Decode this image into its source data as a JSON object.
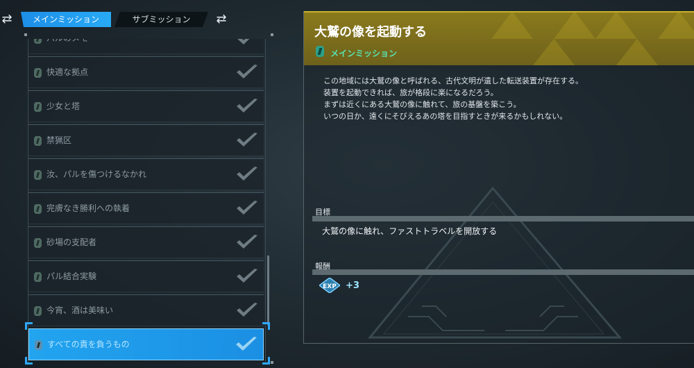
{
  "tabs": {
    "main_label": "メインミッション",
    "sub_label": "サブミッション"
  },
  "quest_list": {
    "items": [
      {
        "label": "パルのメモ",
        "completed": true
      },
      {
        "label": "快適な拠点",
        "completed": true
      },
      {
        "label": "少女と塔",
        "completed": true
      },
      {
        "label": "禁猟区",
        "completed": true
      },
      {
        "label": "汝、パルを傷つけるなかれ",
        "completed": true
      },
      {
        "label": "完膚なき勝利への執着",
        "completed": true
      },
      {
        "label": "砂場の支配者",
        "completed": true
      },
      {
        "label": "パル結合実験",
        "completed": true
      },
      {
        "label": "今宵、酒は美味い",
        "completed": true
      },
      {
        "label": "すべての責を負うもの",
        "completed": true,
        "selected": true
      }
    ]
  },
  "detail": {
    "title": "大鷲の像を起動する",
    "category": "メインミッション",
    "description": [
      "この地域には大鷲の像と呼ばれる、古代文明が遺した転送装置が存在する。",
      "装置を起動できれば、旅が格段に楽になるだろう。",
      "まずは近くにある大鷲の像に触れて、旅の基盤を築こう。",
      "いつの日か、遠くにそびえるあの塔を目指すときが来るかもしれない。"
    ],
    "objective_heading": "目標",
    "objective_text": "大鷲の像に触れ、ファストトラベルを開放する",
    "reward_heading": "報酬",
    "reward_icon_label": "EXP",
    "reward_value": "+3"
  },
  "colors": {
    "accent_blue": "#1d8fe8",
    "header_gold": "#8a7a1c",
    "mission_green": "#59e4b4"
  }
}
